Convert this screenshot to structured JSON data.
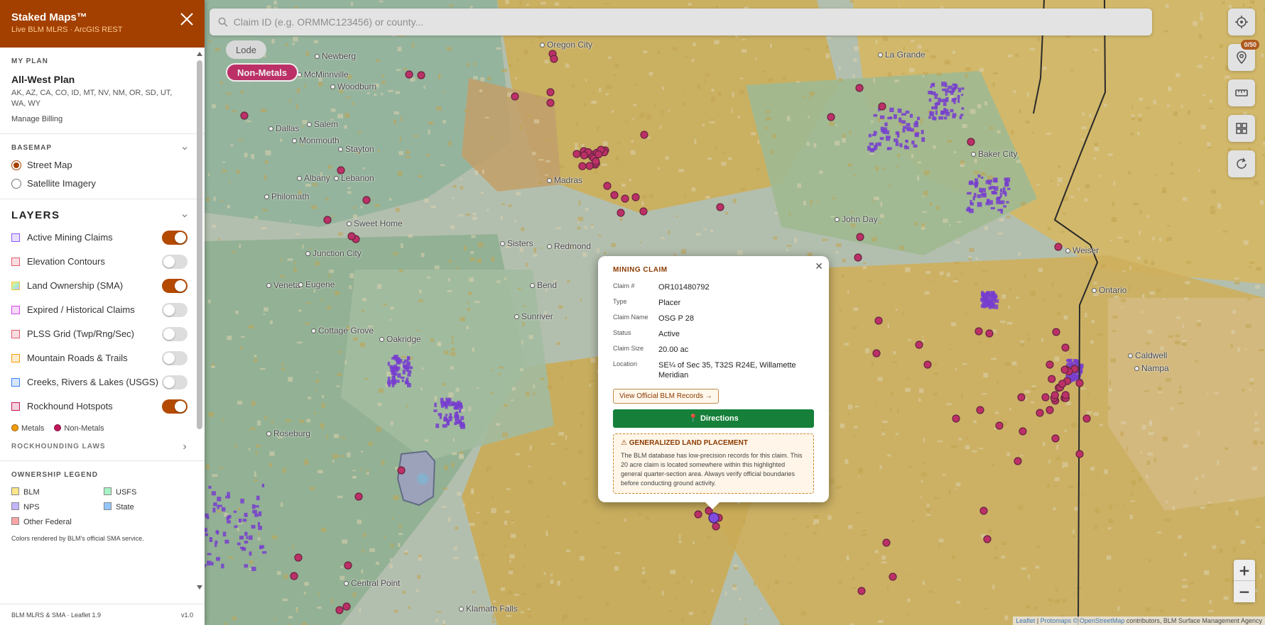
{
  "search": {
    "placeholder": "Claim ID (e.g. ORMMC123456) or county..."
  },
  "filters": {
    "lode": "Lode",
    "non_metals": "Non-Metals"
  },
  "tools": {
    "count_badge": "0/50"
  },
  "map_labels": [
    "Oregon City",
    "Newberg",
    "McMinnville",
    "Woodburn",
    "Dallas",
    "Salem",
    "Monmouth",
    "Stayton",
    "Albany",
    "Lebanon",
    "Philomath",
    "Sweet Home",
    "Junction City",
    "Veneta",
    "Eugene",
    "Cottage Grove",
    "Oakridge",
    "Roseburg",
    "Madras",
    "Sisters",
    "Redmond",
    "Bend",
    "Sunriver",
    "John Day",
    "La Grande",
    "Baker City",
    "Weiser",
    "Ontario",
    "Caldwell",
    "Nampa",
    "Central Point",
    "Klamath Falls"
  ],
  "attribution": {
    "leaflet": "Leaflet",
    "protomaps": "Protomaps",
    "osm": "© OpenStreetMap",
    "rest": "contributors, BLM Surface Management Agency"
  },
  "sidebar": {
    "title": "Staked Maps™",
    "subtitle": "Live BLM MLRS · ArcGIS REST",
    "my_plan": {
      "label": "MY PLAN",
      "name": "All-West Plan",
      "states": "AK, AZ, CA, CO, ID, MT, NV, NM, OR, SD, UT, WA, WY",
      "billing": "Manage Billing"
    },
    "basemap": {
      "label": "BASEMAP",
      "options": [
        "Street Map",
        "Satellite Imagery"
      ],
      "selected": "Street Map"
    },
    "layers": {
      "title": "LAYERS",
      "items": [
        {
          "label": "Active Mining Claims",
          "on": true,
          "color": "#8b5cf6"
        },
        {
          "label": "Elevation Contours",
          "on": false,
          "color": "#e05a6a"
        },
        {
          "label": "Land Ownership (SMA)",
          "on": true,
          "color": "#f5c542"
        },
        {
          "label": "Expired / Historical Claims",
          "on": false,
          "color": "#d946ef"
        },
        {
          "label": "PLSS Grid (Twp/Rng/Sec)",
          "on": false,
          "color": "#e05a6a"
        },
        {
          "label": "Mountain Roads & Trails",
          "on": false,
          "color": "#f59e0b"
        },
        {
          "label": "Creeks, Rivers & Lakes (USGS)",
          "on": false,
          "color": "#3b82f6"
        },
        {
          "label": "Rockhound Hotspots",
          "on": true,
          "color": "#c2185b"
        }
      ],
      "legend": {
        "metals": "Metals",
        "non_metals": "Non-Metals"
      },
      "laws": "ROCKHOUNDING LAWS"
    },
    "ownership": {
      "label": "OWNERSHIP LEGEND",
      "items": [
        {
          "label": "BLM",
          "color": "#fde68a"
        },
        {
          "label": "USFS",
          "color": "#a7f3c5"
        },
        {
          "label": "NPS",
          "color": "#c4b5fd"
        },
        {
          "label": "State",
          "color": "#93c5fd"
        },
        {
          "label": "Other Federal",
          "color": "#fca5a5"
        }
      ],
      "note": "Colors rendered by BLM's official SMA service."
    },
    "footer": {
      "left": "BLM MLRS & SMA · Leaflet 1.9",
      "right": "v1.0"
    }
  },
  "popup": {
    "title": "MINING CLAIM",
    "fields": [
      {
        "k": "Claim #",
        "v": "OR101480792"
      },
      {
        "k": "Type",
        "v": "Placer"
      },
      {
        "k": "Claim Name",
        "v": "OSG P 28"
      },
      {
        "k": "Status",
        "v": "Active"
      },
      {
        "k": "Claim Size",
        "v": "20.00 ac"
      },
      {
        "k": "Location",
        "v": "SE¼ of Sec 35, T32S R24E, Willamette Meridian"
      }
    ],
    "blm_button": "View Official BLM Records →",
    "directions_button": "📍 Directions",
    "warning_title": "⚠ GENERALIZED LAND PLACEMENT",
    "warning_text": "The BLM database has low-precision records for this claim. This 20 acre claim is located somewhere within this highlighted general quarter-section area. Always verify official boundaries before conducting ground activity."
  }
}
